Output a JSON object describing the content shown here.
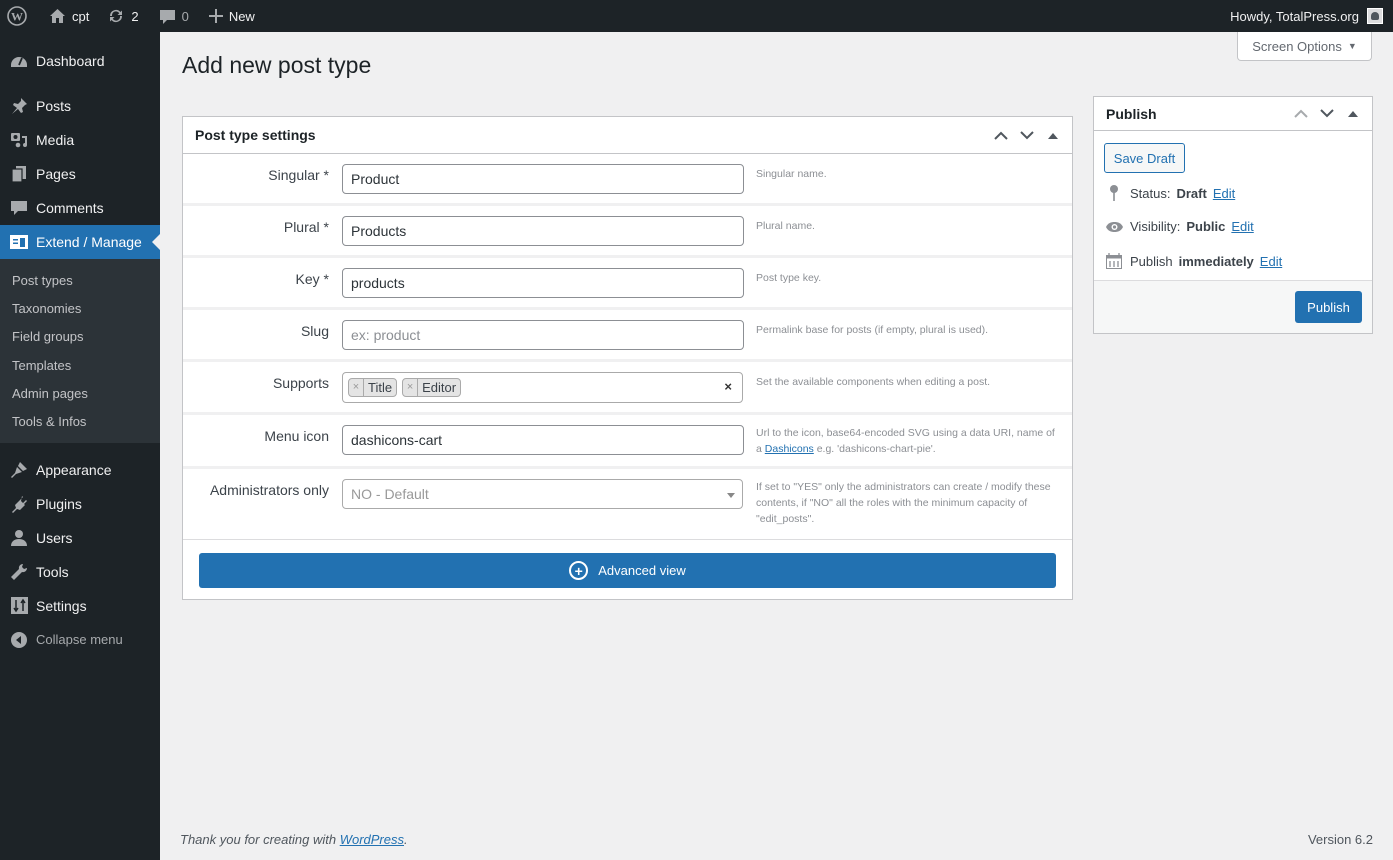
{
  "adminbar": {
    "site_name": "cpt",
    "updates_count": "2",
    "comments_count": "0",
    "new_label": "New",
    "greeting": "Howdy, TotalPress.org"
  },
  "sidebar": {
    "items": [
      {
        "label": "Dashboard",
        "icon": "dashboard-icon"
      },
      {
        "label": "Posts",
        "icon": "pin-icon"
      },
      {
        "label": "Media",
        "icon": "media-icon"
      },
      {
        "label": "Pages",
        "icon": "pages-icon"
      },
      {
        "label": "Comments",
        "icon": "comment-icon"
      },
      {
        "label": "Extend / Manage",
        "icon": "columns-icon",
        "active": true
      },
      {
        "label": "Appearance",
        "icon": "brush-icon"
      },
      {
        "label": "Plugins",
        "icon": "plugin-icon"
      },
      {
        "label": "Users",
        "icon": "user-icon"
      },
      {
        "label": "Tools",
        "icon": "wrench-icon"
      },
      {
        "label": "Settings",
        "icon": "sliders-icon"
      }
    ],
    "submenu": [
      "Post types",
      "Taxonomies",
      "Field groups",
      "Templates",
      "Admin pages",
      "Tools & Infos"
    ],
    "collapse_label": "Collapse menu"
  },
  "screen_options_label": "Screen Options",
  "page_title": "Add new post type",
  "settings": {
    "title": "Post type settings",
    "fields": {
      "singular": {
        "label": "Singular *",
        "value": "Product",
        "desc": "Singular name."
      },
      "plural": {
        "label": "Plural *",
        "value": "Products",
        "desc": "Plural name."
      },
      "key": {
        "label": "Key *",
        "value": "products",
        "desc": "Post type key."
      },
      "slug": {
        "label": "Slug",
        "value": "",
        "placeholder": "ex: product",
        "desc": "Permalink base for posts (if empty, plural is used)."
      },
      "supports": {
        "label": "Supports",
        "tags": [
          "Title",
          "Editor"
        ],
        "desc": "Set the available components when editing a post."
      },
      "menu_icon": {
        "label": "Menu icon",
        "value": "dashicons-cart",
        "desc_before": "Url to the icon, base64-encoded SVG using a data URI, name of a ",
        "desc_link": "Dashicons",
        "desc_after": " e.g. 'dashicons-chart-pie'."
      },
      "admins_only": {
        "label": "Administrators only",
        "value": "NO - Default",
        "desc": "If set to \"YES\" only the administrators can create / modify these contents, if \"NO\" all the roles with the minimum capacity of \"edit_posts\"."
      }
    },
    "advanced_label": "Advanced view"
  },
  "publish": {
    "title": "Publish",
    "save_draft_label": "Save Draft",
    "status_label": "Status:",
    "status_value": "Draft",
    "visibility_label": "Visibility:",
    "visibility_value": "Public",
    "publish_label": "Publish",
    "publish_value": "immediately",
    "edit_label": "Edit",
    "publish_button": "Publish"
  },
  "footer": {
    "thanks_before": "Thank you for creating with ",
    "thanks_link": "WordPress",
    "thanks_after": ".",
    "version": "Version 6.2"
  },
  "colors": {
    "accent": "#2271b1",
    "adminbar": "#1d2327",
    "submenu_bg": "#2c3338"
  }
}
